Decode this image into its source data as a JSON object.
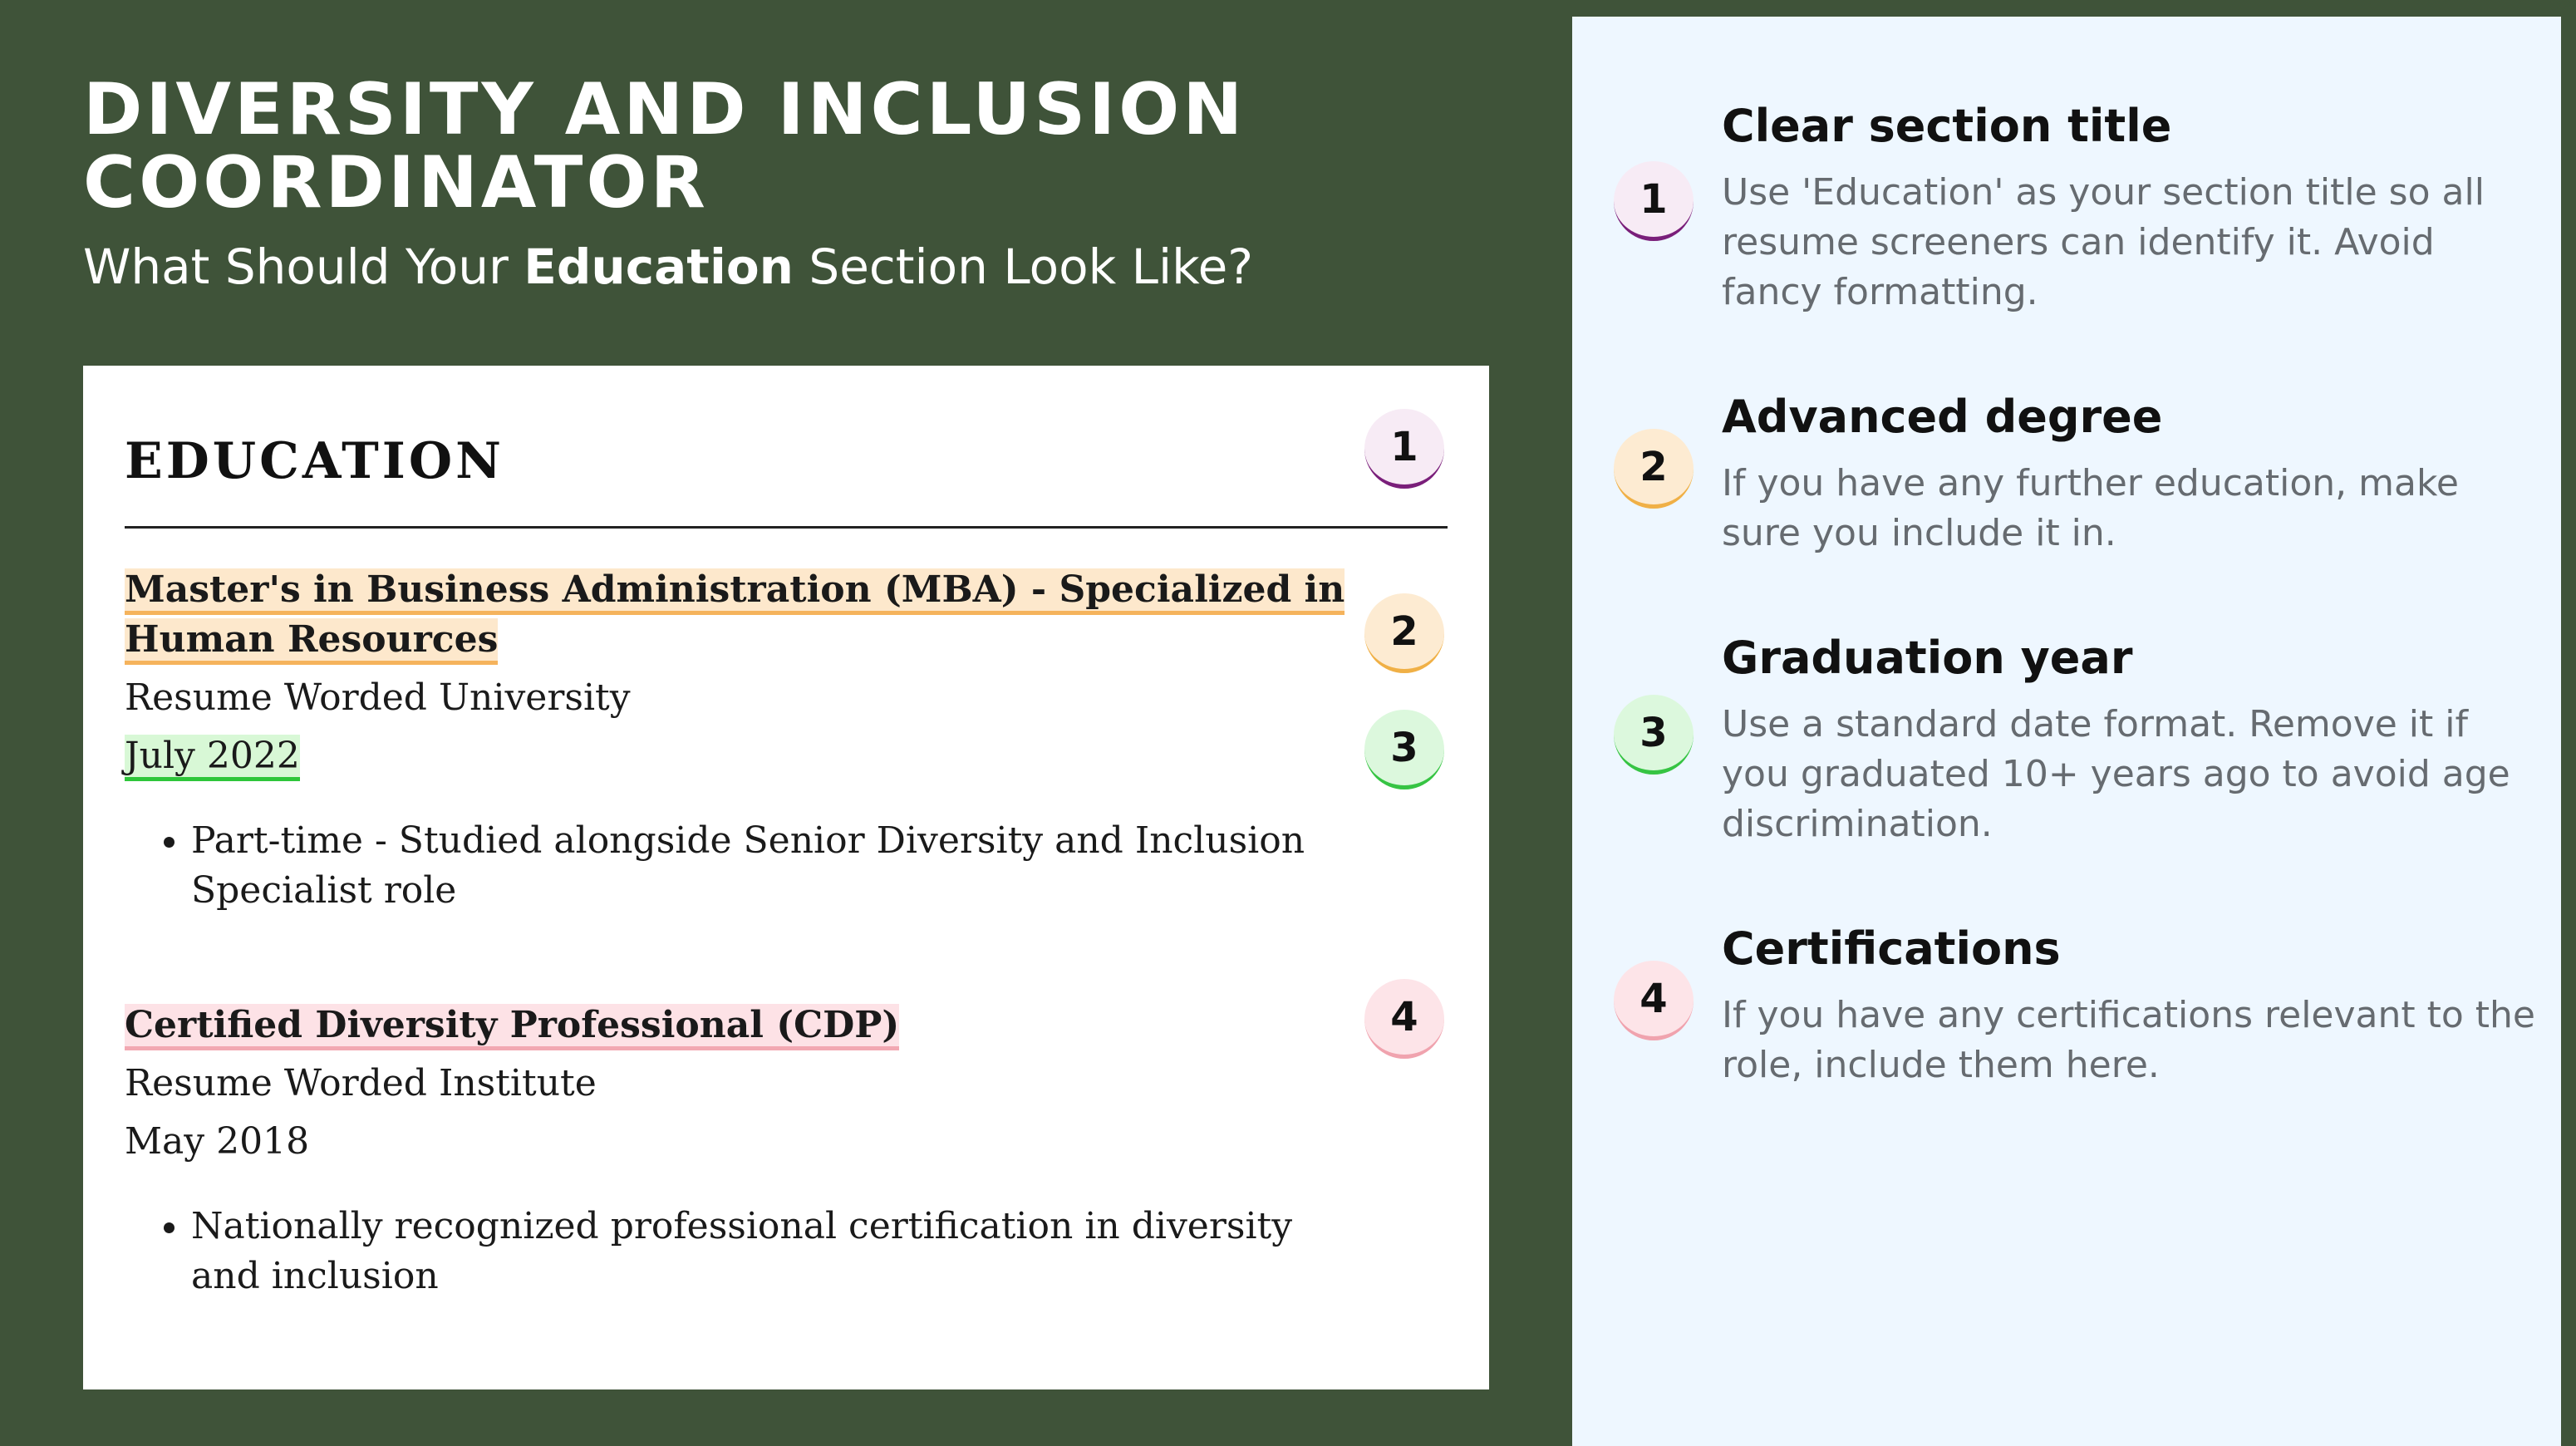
{
  "header": {
    "title": "DIVERSITY AND INCLUSION COORDINATOR",
    "subtitle_pre": "What Should Your ",
    "subtitle_bold": "Education",
    "subtitle_post": " Section Look Like?"
  },
  "resume": {
    "heading": "EDUCATION",
    "entries": [
      {
        "degree": "Master's in Business Administration (MBA) - Specialized in Human Resources",
        "institution": "Resume Worded University",
        "date": "July 2022",
        "bullet": "Part-time - Studied alongside Senior Diversity and Inclusion Specialist role"
      },
      {
        "degree": "Certified Diversity Professional (CDP)",
        "institution": "Resume Worded Institute",
        "date": "May 2018",
        "bullet": "Nationally recognized professional certification in diversity and inclusion"
      }
    ],
    "badges": [
      "1",
      "2",
      "3",
      "4"
    ]
  },
  "tips": [
    {
      "number": "1",
      "title": "Clear section title",
      "description": "Use 'Education' as your section title so all resume screeners can identify it. Avoid fancy formatting."
    },
    {
      "number": "2",
      "title": "Advanced degree",
      "description": "If you have any further education, make sure you include it in."
    },
    {
      "number": "3",
      "title": "Graduation year",
      "description": "Use a standard date format. Remove it if you graduated 10+ years ago to avoid age discrimination."
    },
    {
      "number": "4",
      "title": "Certifications",
      "description": "If you have any certifications relevant to the role, include them here."
    }
  ],
  "colors": {
    "background": "#3f5339",
    "panel": "#eef7ff",
    "badge_1_accent": "#7a1f7a",
    "badge_2_accent": "#f0b046",
    "badge_3_accent": "#36c443",
    "badge_4_accent": "#f0a3ae"
  }
}
